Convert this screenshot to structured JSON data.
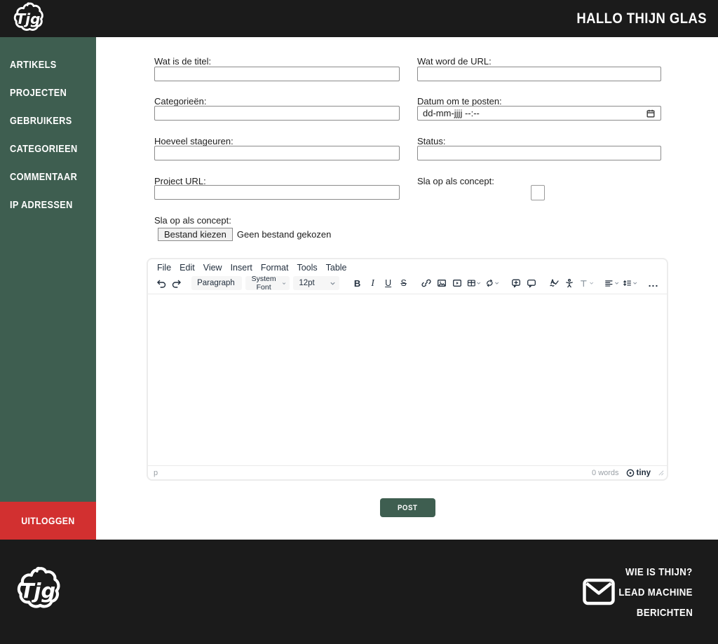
{
  "colors": {
    "header_black": "#1b1b1b",
    "sidebar_green": "#3e5e50",
    "logout_red": "#d23030",
    "post_green": "#3e5e50",
    "editor_icon": "#222f3e"
  },
  "header": {
    "title": "HALLO THIJN GLAS"
  },
  "sidebar": {
    "items": [
      "ARTIKELS",
      "PROJECTEN",
      "GEBRUIKERS",
      "CATEGORIEEN",
      "COMMENTAAR",
      "IP ADRESSEN"
    ],
    "logout_label": "UITLOGGEN"
  },
  "form": {
    "fields": {
      "title": {
        "label": "Wat is de titel:"
      },
      "url": {
        "label": "Wat word de URL:"
      },
      "categories": {
        "label": "Categorieën:"
      },
      "date": {
        "label": "Datum om te posten:",
        "value": "dd-mm-jjjj --:--"
      },
      "hours": {
        "label": "Hoeveel stageuren:"
      },
      "status": {
        "label": "Status:"
      },
      "project_url": {
        "label": "Project URL:"
      },
      "concept_checkbox": {
        "label": "Sla op als concept:"
      },
      "concept_file": {
        "label": "Sla op als concept:",
        "button": "Bestand kiezen",
        "no_file": "Geen bestand gekozen"
      }
    },
    "post_label": "POST"
  },
  "editor": {
    "menu": [
      "File",
      "Edit",
      "View",
      "Insert",
      "Format",
      "Tools",
      "Table"
    ],
    "dropdowns": {
      "block": "Paragraph",
      "font": "System Font",
      "size": "12pt"
    },
    "format_icons": {
      "bold": "B",
      "italic": "I",
      "underline": "U",
      "strikethrough": "S",
      "more": "..."
    },
    "statusbar": {
      "path": "p",
      "words": "0 words",
      "brand": "tiny"
    }
  },
  "footer": {
    "links": [
      "WIE IS THIJN?",
      "LEAD MACHINE",
      "BERICHTEN"
    ]
  }
}
